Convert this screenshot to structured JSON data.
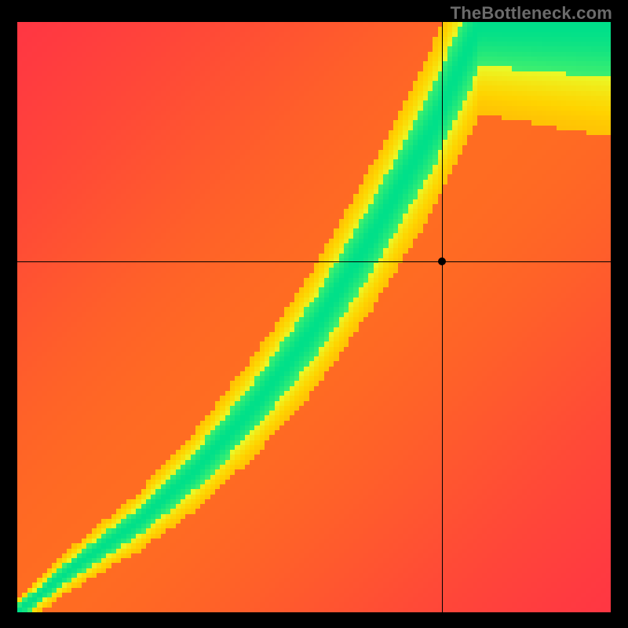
{
  "watermark": "TheBottleneck.com",
  "chart_data": {
    "type": "heatmap",
    "title": "",
    "xlabel": "",
    "ylabel": "",
    "xlim": [
      0,
      1
    ],
    "ylim": [
      0,
      1
    ],
    "grid": false,
    "resolution": 120,
    "crosshair": {
      "x": 0.716,
      "y": 0.595
    },
    "marker": {
      "x": 0.716,
      "y": 0.595
    },
    "ridge": {
      "anchors": [
        {
          "x": 0.0,
          "y": 0.0
        },
        {
          "x": 0.1,
          "y": 0.08
        },
        {
          "x": 0.2,
          "y": 0.15
        },
        {
          "x": 0.3,
          "y": 0.24
        },
        {
          "x": 0.4,
          "y": 0.35
        },
        {
          "x": 0.5,
          "y": 0.48
        },
        {
          "x": 0.6,
          "y": 0.64
        },
        {
          "x": 0.7,
          "y": 0.82
        },
        {
          "x": 0.78,
          "y": 1.0
        }
      ],
      "width_anchors": [
        {
          "x": 0.0,
          "w": 0.01
        },
        {
          "x": 0.2,
          "w": 0.02
        },
        {
          "x": 0.4,
          "w": 0.035
        },
        {
          "x": 0.6,
          "w": 0.05
        },
        {
          "x": 0.8,
          "w": 0.065
        },
        {
          "x": 1.0,
          "w": 0.08
        }
      ]
    },
    "color_stops": [
      {
        "t": 0.0,
        "c": "#ff2a4b"
      },
      {
        "t": 0.38,
        "c": "#ff7a1a"
      },
      {
        "t": 0.62,
        "c": "#ffd400"
      },
      {
        "t": 0.8,
        "c": "#e7ff2e"
      },
      {
        "t": 0.92,
        "c": "#7cff55"
      },
      {
        "t": 1.0,
        "c": "#00e08a"
      }
    ],
    "diag_bonus": 0.35,
    "diag_bonus_sigma": 0.55
  }
}
